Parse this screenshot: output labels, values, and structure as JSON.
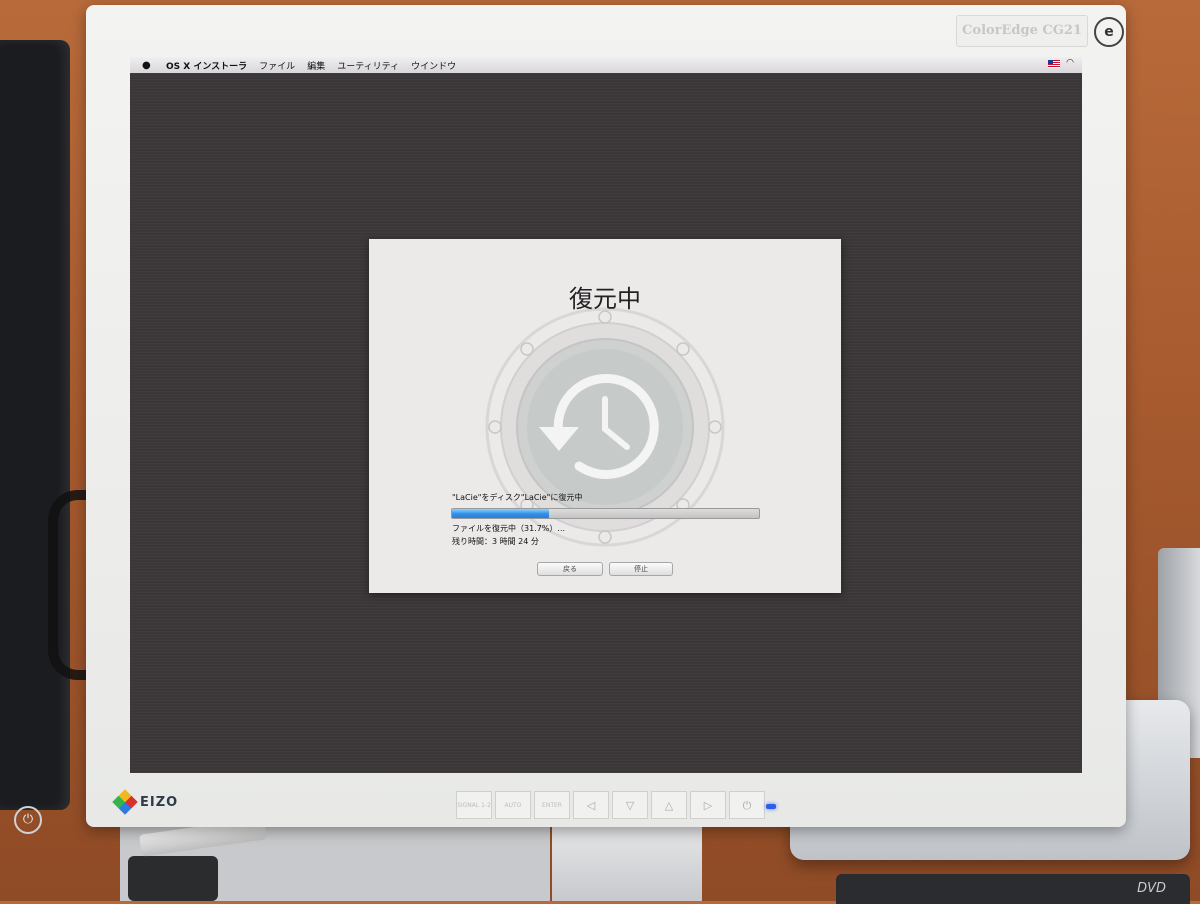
{
  "menubar": {
    "apple_icon": "apple-icon",
    "items": [
      "OS X インストーラ",
      "ファイル",
      "編集",
      "ユーティリティ",
      "ウインドウ"
    ],
    "right_icons": [
      "flag-icon",
      "wifi-icon"
    ]
  },
  "installer": {
    "title": "復元中",
    "status_line": "\"LaCie\"をディスク\"LaCie\"に復元中",
    "progress_text": "ファイルを復元中（31.7%）...",
    "progress_fraction": 0.317,
    "remaining_text": "残り時間：3 時間 24 分",
    "back_label": "戻る",
    "stop_label": "停止"
  },
  "monitor": {
    "model_label": "ColorEdge CG21",
    "brand": "EIZO",
    "control_labels": [
      "SIGNAL 1-2",
      "AUTO",
      "ENTER"
    ],
    "badge": "e"
  },
  "colors": {
    "screen_bg": "#3b3739",
    "progress_fill": "#2f8fe8",
    "dialog_bg": "#ece9e9"
  }
}
